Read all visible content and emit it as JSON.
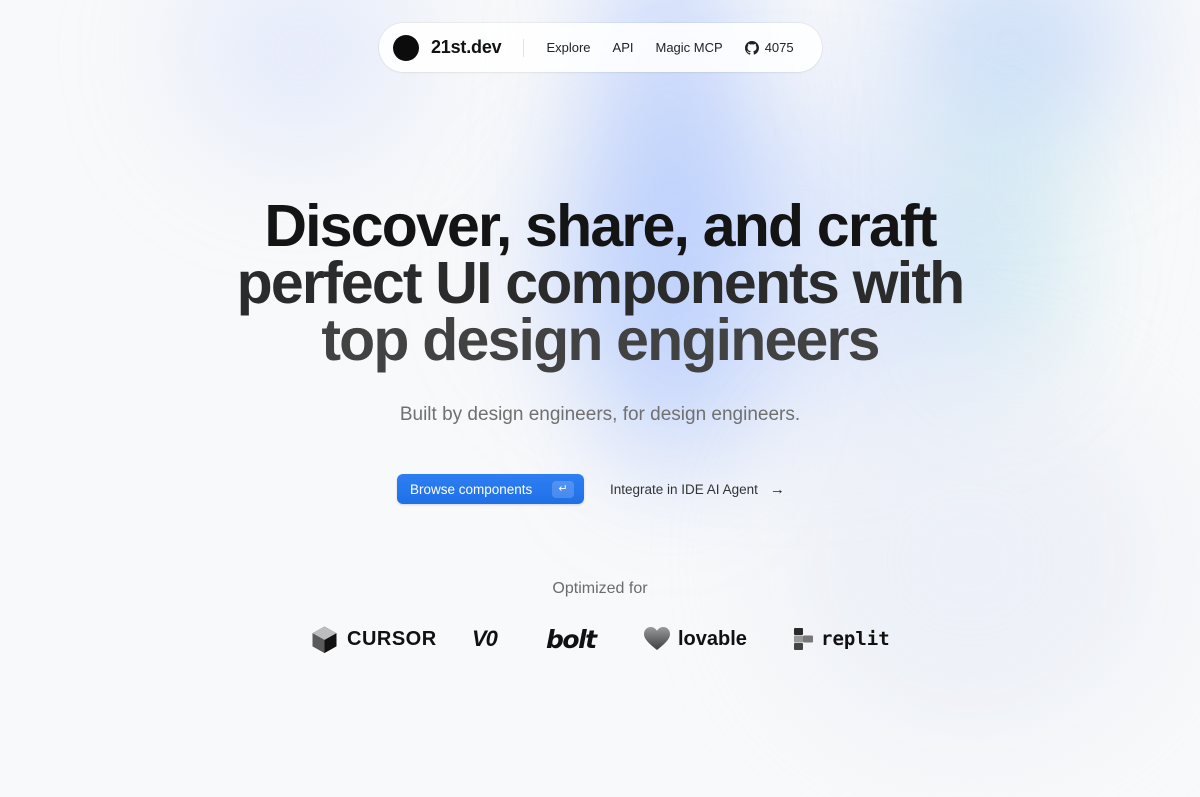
{
  "nav": {
    "brand": "21st.dev",
    "links": [
      "Explore",
      "API",
      "Magic MCP"
    ],
    "github_stars": "4075"
  },
  "hero": {
    "title_lines": [
      "Discover, share, and craft",
      "perfect UI components with",
      "top design engineers"
    ],
    "subtitle": "Built by design engineers, for design engineers."
  },
  "cta": {
    "primary_label": "Browse components",
    "primary_shortcut": "↵",
    "secondary_label": "Integrate in IDE AI Agent",
    "secondary_icon": "arrow-right-icon"
  },
  "partners": {
    "heading": "Optimized for",
    "items": [
      {
        "name": "CURSOR",
        "icon": "cursor-logo-icon"
      },
      {
        "name": "V0",
        "icon": "v0-logo-icon"
      },
      {
        "name": "bolt",
        "icon": "bolt-logo-icon"
      },
      {
        "name": "lovable",
        "icon": "heart-logo-icon"
      },
      {
        "name": "replit",
        "icon": "replit-logo-icon"
      }
    ]
  },
  "colors": {
    "primary_button": "#2577ee",
    "background": "#f8f9fa",
    "accent_glow": "#a8c0ff"
  }
}
